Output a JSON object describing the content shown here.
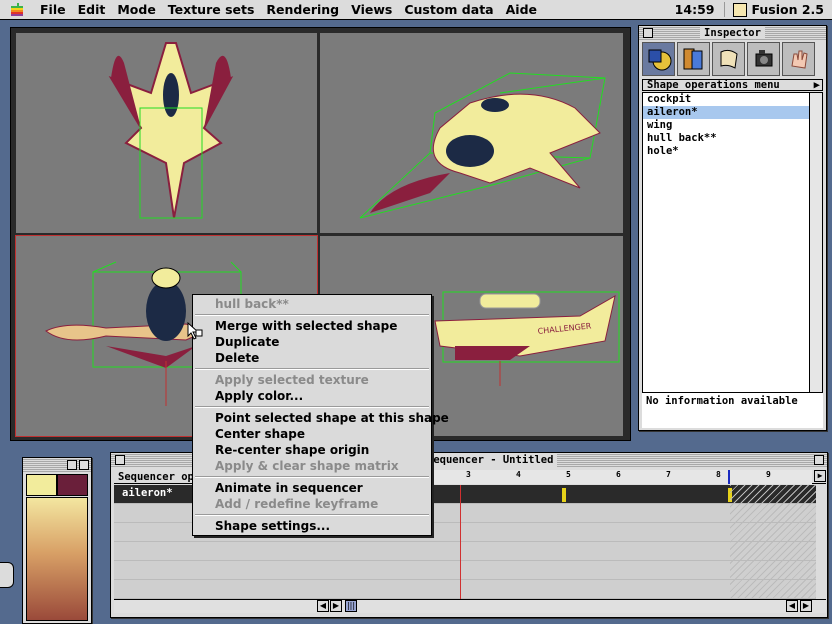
{
  "menubar": {
    "items": [
      "File",
      "Edit",
      "Mode",
      "Texture sets",
      "Rendering",
      "Views",
      "Custom data",
      "Aide"
    ],
    "clock": "14:59",
    "app_name": "Fusion 2.5"
  },
  "inspector": {
    "title": "Inspector",
    "tools": [
      "shapes-tool-icon",
      "textures-tool-icon",
      "scroll-tool-icon",
      "camera-tool-icon",
      "hand-tool-icon"
    ],
    "op_menu_label": "Shape operations menu",
    "shapes": [
      "cockpit",
      "aileron*",
      "wing",
      "hull back**",
      "hole*"
    ],
    "selected_shape": "aileron*",
    "info": "No information available"
  },
  "sequencer": {
    "title": "Sequencer - Untitled",
    "label_header": "Sequencer op",
    "track": "aileron*",
    "ticks": [
      "3",
      "4",
      "5",
      "6",
      "7",
      "8",
      "9"
    ]
  },
  "viewports": {
    "decal_text": "CHALLENGER"
  },
  "context_menu": {
    "header": "hull back**",
    "items": [
      {
        "label": "Merge with selected shape",
        "enabled": true
      },
      {
        "label": "Duplicate",
        "enabled": true
      },
      {
        "label": "Delete",
        "enabled": true
      },
      {
        "label": "Apply selected texture",
        "enabled": false
      },
      {
        "label": "Apply color...",
        "enabled": true
      },
      {
        "label": "Point selected shape at this shape",
        "enabled": true
      },
      {
        "label": "Center shape",
        "enabled": true
      },
      {
        "label": "Re-center shape origin",
        "enabled": true
      },
      {
        "label": "Apply & clear shape matrix",
        "enabled": false
      },
      {
        "label": "Animate in sequencer",
        "enabled": true
      },
      {
        "label": "Add / redefine keyframe",
        "enabled": false
      },
      {
        "label": "Shape settings...",
        "enabled": true
      }
    ]
  },
  "colors": {
    "desktop": "#546a8e",
    "viewport_bg": "#7b7b7b",
    "bbox_green": "#22dd22",
    "ship_body": "#f2ec9c",
    "ship_accent": "#8a1f3e",
    "selection": "#a8c8ee"
  }
}
